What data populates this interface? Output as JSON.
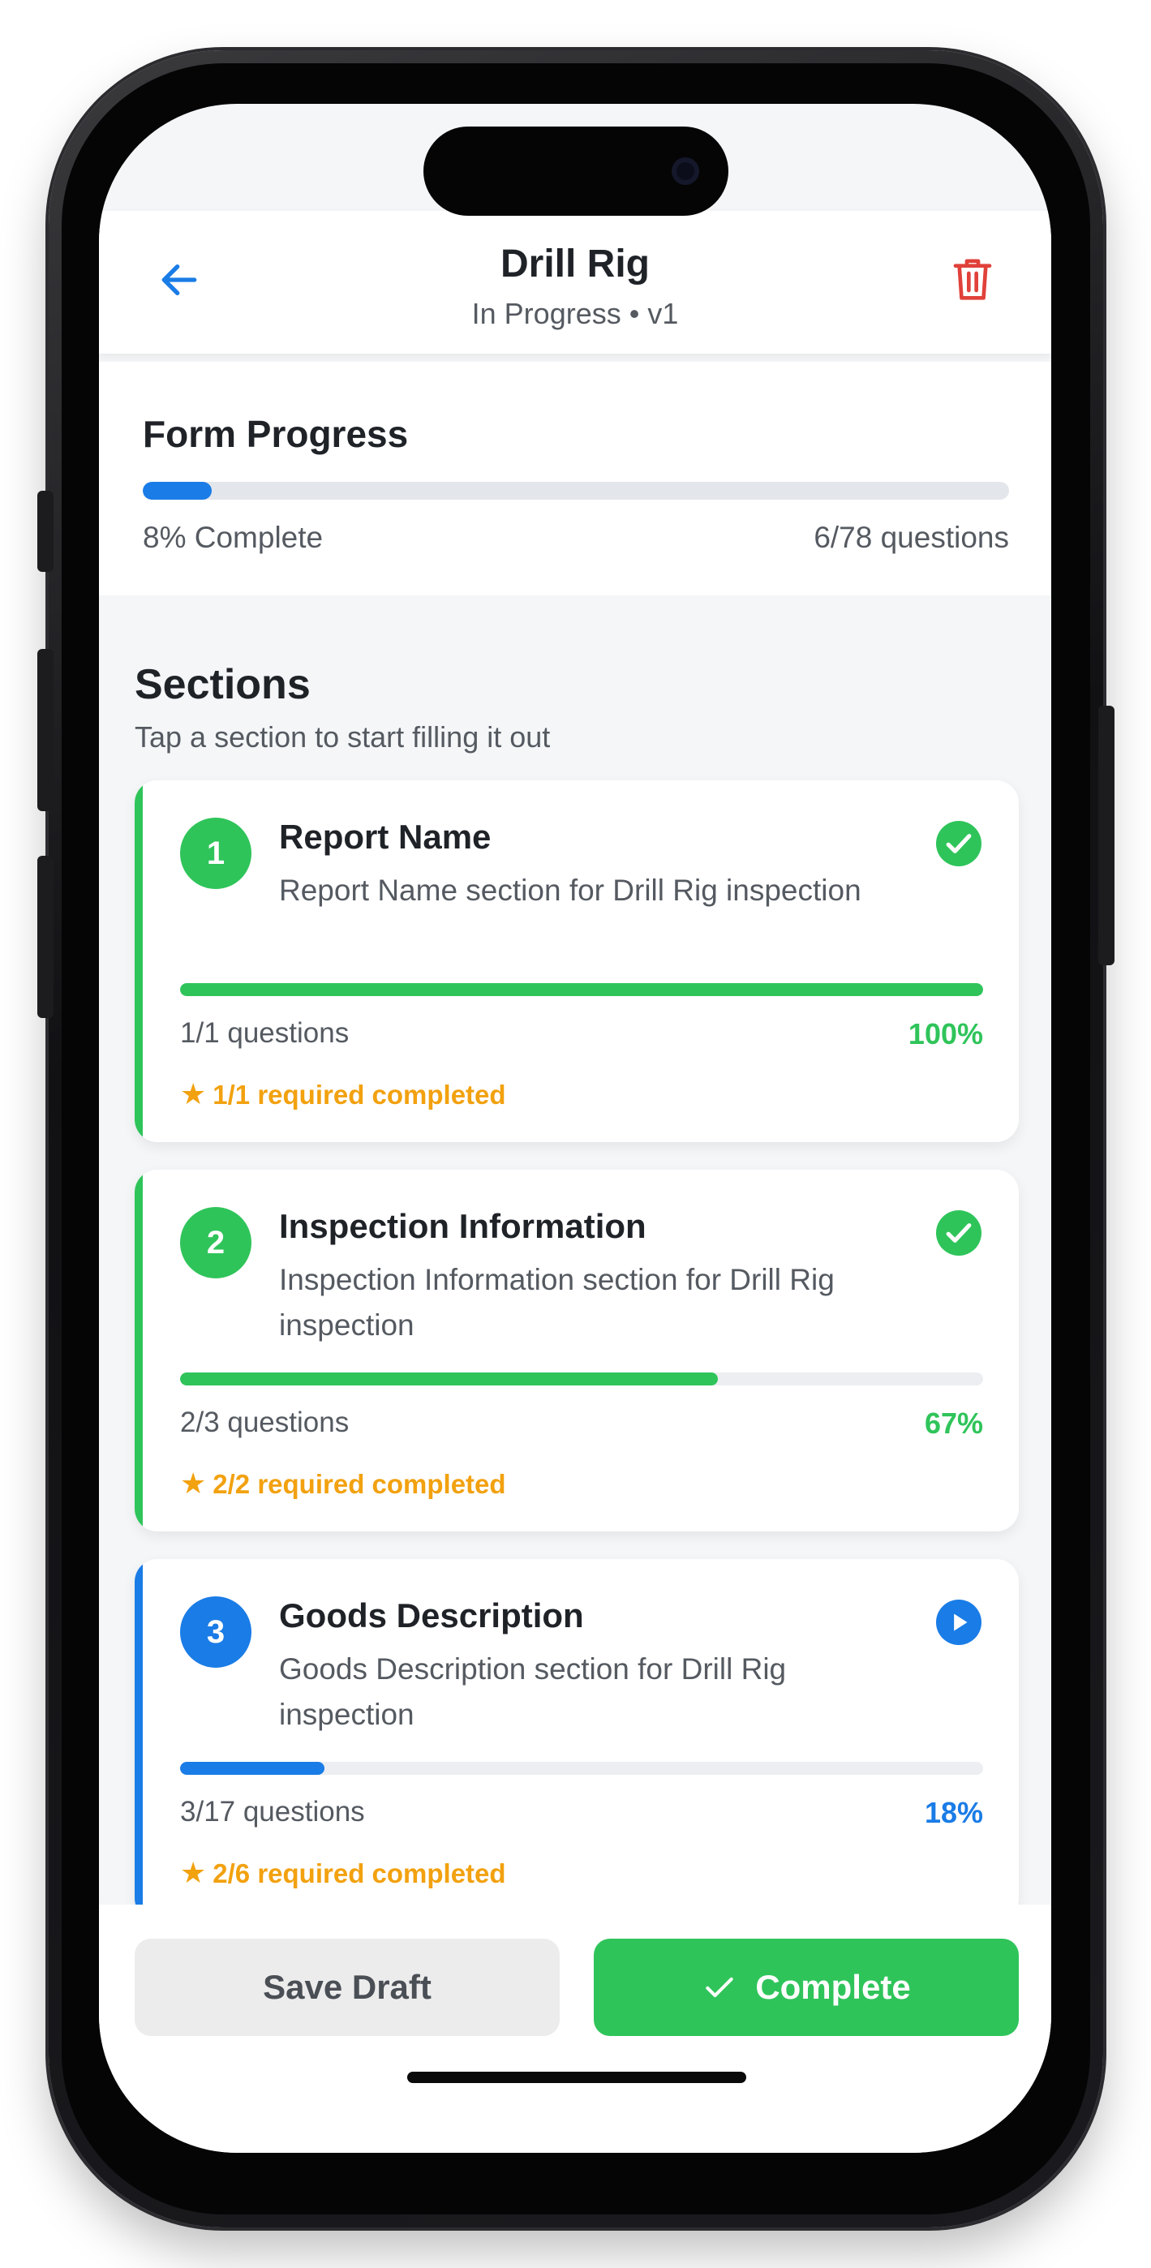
{
  "header": {
    "title": "Drill Rig",
    "subtitle": "In Progress • v1",
    "back_icon": "arrow-left-icon",
    "delete_icon": "trash-icon",
    "accent_color": "#1a7ce6",
    "delete_color": "#e0413a"
  },
  "form_progress": {
    "title": "Form Progress",
    "percent_label": "8% Complete",
    "questions_label": "6/78 questions",
    "fraction": 0.08
  },
  "sections": {
    "title": "Sections",
    "subtitle": "Tap a section to start filling it out",
    "items": [
      {
        "number": "1",
        "title": "Report Name",
        "description": "Report Name section for Drill Rig inspection",
        "questions": "1/1 questions",
        "percent": "100%",
        "required": "1/1 required completed",
        "fraction": 1.0,
        "status": "complete",
        "status_icon": "check-circle-icon",
        "color": "#2fc45a"
      },
      {
        "number": "2",
        "title": "Inspection Information",
        "description": "Inspection Information section for Drill Rig inspection",
        "questions": "2/3 questions",
        "percent": "67%",
        "required": "2/2 required completed",
        "fraction": 0.67,
        "status": "complete",
        "status_icon": "check-circle-icon",
        "color": "#2fc45a"
      },
      {
        "number": "3",
        "title": "Goods Description",
        "description": "Goods Description section for Drill Rig inspection",
        "questions": "3/17 questions",
        "percent": "18%",
        "required": "2/6 required completed",
        "fraction": 0.18,
        "status": "in-progress",
        "status_icon": "play-circle-icon",
        "color": "#1a7ce6"
      }
    ]
  },
  "actions": {
    "save_label": "Save Draft",
    "complete_label": "Complete",
    "complete_icon": "check-icon",
    "complete_color": "#2fc45a"
  },
  "colors": {
    "required_star": "#f2a10f",
    "success": "#2fc45a",
    "primary": "#1a7ce6"
  }
}
